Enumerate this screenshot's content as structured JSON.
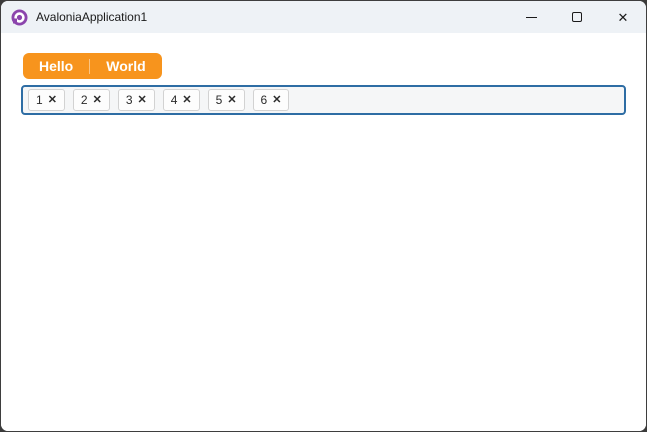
{
  "window": {
    "title": "AvaloniaApplication1",
    "close_glyph": "✕"
  },
  "tabs": [
    {
      "label": "Hello"
    },
    {
      "label": "World"
    }
  ],
  "taginput": {
    "remove_glyph": "✕",
    "chips": [
      {
        "value": "1"
      },
      {
        "value": "2"
      },
      {
        "value": "3"
      },
      {
        "value": "4"
      },
      {
        "value": "5"
      },
      {
        "value": "6"
      }
    ]
  },
  "colors": {
    "accent_orange": "#F7941D",
    "focus_border": "#2E6DA4",
    "logo_purple": "#8B44AC",
    "titlebar_bg": "#EEF2F6"
  }
}
